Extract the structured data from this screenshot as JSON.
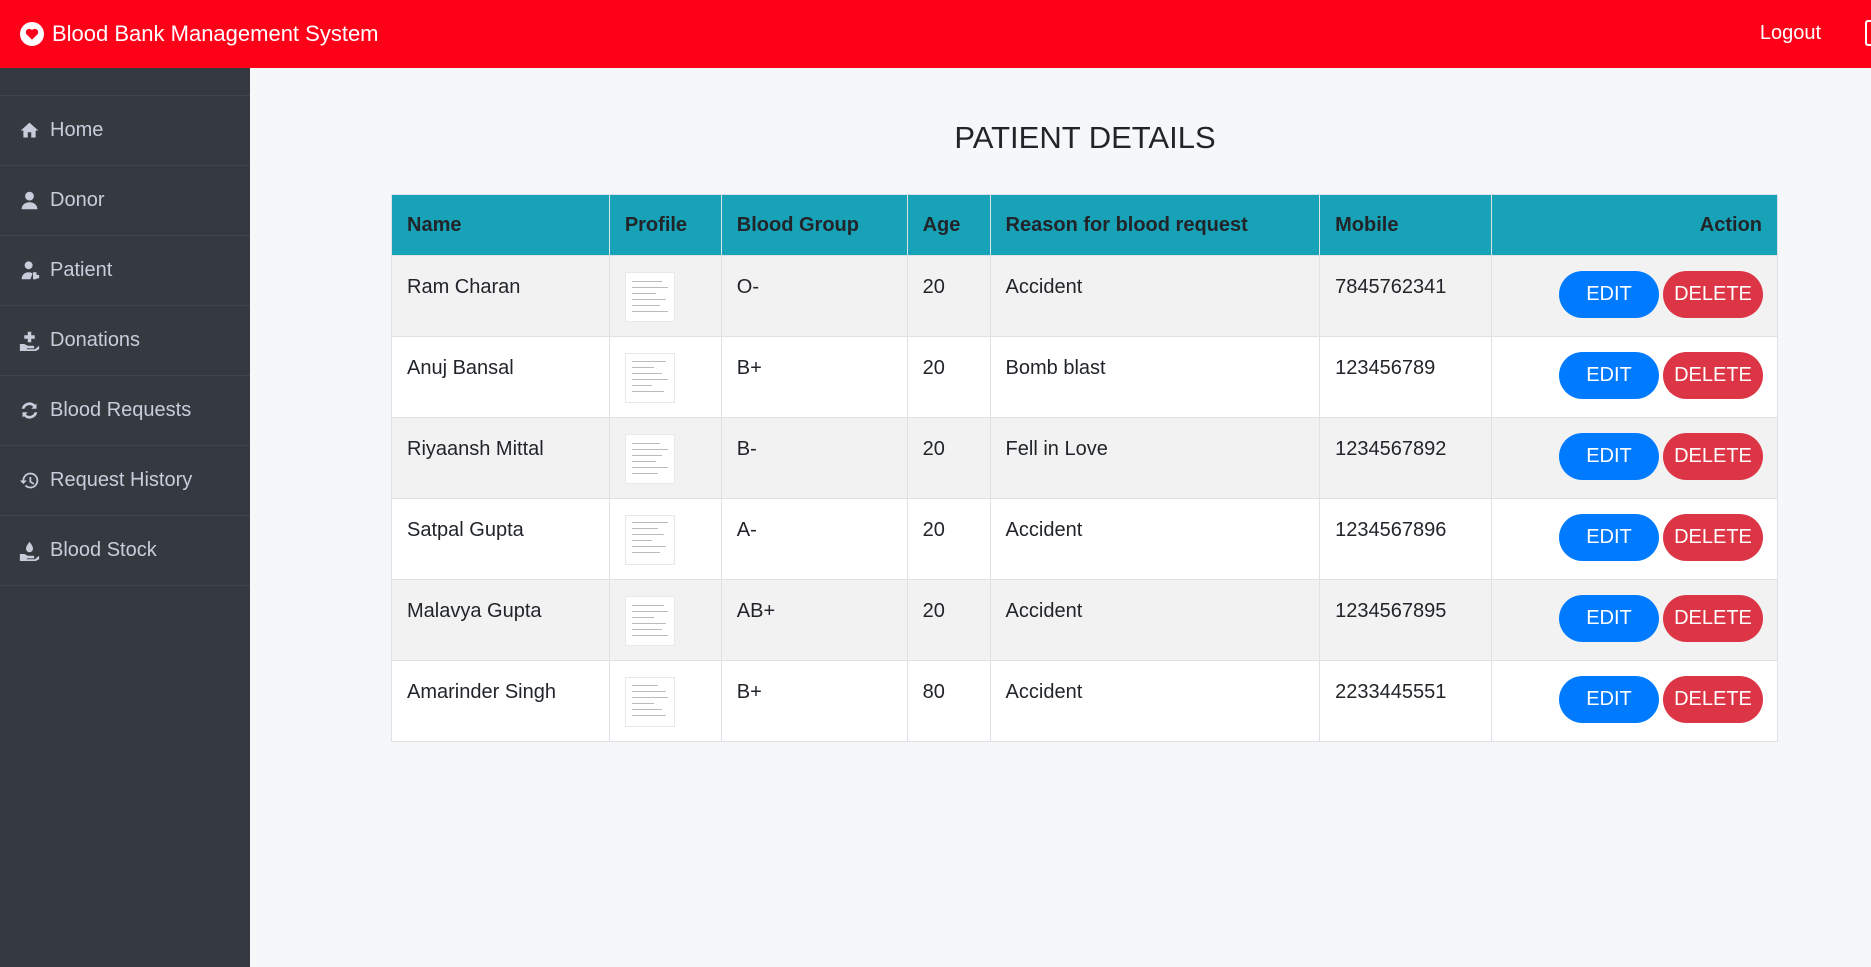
{
  "header": {
    "title": "Blood Bank Management System",
    "logout_label": "Logout"
  },
  "sidebar": {
    "items": [
      {
        "label": "Home",
        "icon": "home-icon"
      },
      {
        "label": "Donor",
        "icon": "user-icon"
      },
      {
        "label": "Patient",
        "icon": "patient-icon"
      },
      {
        "label": "Donations",
        "icon": "donation-hand-icon"
      },
      {
        "label": "Blood Requests",
        "icon": "sync-icon"
      },
      {
        "label": "Request History",
        "icon": "history-icon"
      },
      {
        "label": "Blood Stock",
        "icon": "stock-hand-icon"
      }
    ]
  },
  "main": {
    "title": "PATIENT DETAILS",
    "table": {
      "headers": [
        "Name",
        "Profile",
        "Blood Group",
        "Age",
        "Reason for blood request",
        "Mobile",
        "Action"
      ],
      "rows": [
        {
          "name": "Ram Charan",
          "blood_group": "O-",
          "age": "20",
          "reason": "Accident",
          "mobile": "7845762341"
        },
        {
          "name": "Anuj Bansal",
          "blood_group": "B+",
          "age": "20",
          "reason": "Bomb blast",
          "mobile": "123456789"
        },
        {
          "name": "Riyaansh Mittal",
          "blood_group": "B-",
          "age": "20",
          "reason": "Fell in Love",
          "mobile": "1234567892"
        },
        {
          "name": "Satpal Gupta",
          "blood_group": "A-",
          "age": "20",
          "reason": "Accident",
          "mobile": "1234567896"
        },
        {
          "name": "Malavya Gupta",
          "blood_group": "AB+",
          "age": "20",
          "reason": "Accident",
          "mobile": "1234567895"
        },
        {
          "name": "Amarinder Singh",
          "blood_group": "B+",
          "age": "80",
          "reason": "Accident",
          "mobile": "2233445551"
        }
      ],
      "edit_label": "EDIT",
      "delete_label": "DELETE"
    }
  },
  "colors": {
    "header_bg": "#ff0019",
    "sidebar_bg": "#343a40",
    "table_header_bg": "#17a2b8",
    "edit_button": "#007bff",
    "delete_button": "#dc3545"
  }
}
